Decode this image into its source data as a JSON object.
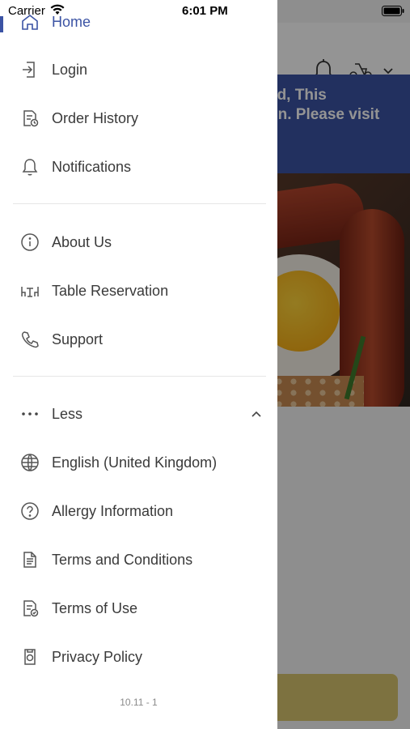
{
  "status_bar": {
    "carrier": "Carrier",
    "time": "6:01 PM"
  },
  "background": {
    "banner_lines": [
      "ed, This",
      "on. Please visit",
      "/"
    ]
  },
  "drawer": {
    "items": [
      {
        "label": "Home",
        "icon": "home-icon"
      },
      {
        "label": "Login",
        "icon": "login-icon"
      },
      {
        "label": "Order History",
        "icon": "order-history-icon"
      },
      {
        "label": "Notifications",
        "icon": "bell-icon"
      },
      {
        "label": "About Us",
        "icon": "info-icon"
      },
      {
        "label": "Table Reservation",
        "icon": "table-icon"
      },
      {
        "label": "Support",
        "icon": "phone-icon"
      },
      {
        "label": "Less",
        "icon": "more-icon"
      },
      {
        "label": "English (United Kingdom)",
        "icon": "globe-icon"
      },
      {
        "label": "Allergy Information",
        "icon": "question-icon"
      },
      {
        "label": "Terms and Conditions",
        "icon": "document-icon"
      },
      {
        "label": "Terms of Use",
        "icon": "document-check-icon"
      },
      {
        "label": "Privacy Policy",
        "icon": "privacy-icon"
      }
    ],
    "version": "10.11 - 1"
  },
  "colors": {
    "accent": "#3b53a4",
    "text": "#3a3a3a",
    "cta": "#d8c56e"
  }
}
